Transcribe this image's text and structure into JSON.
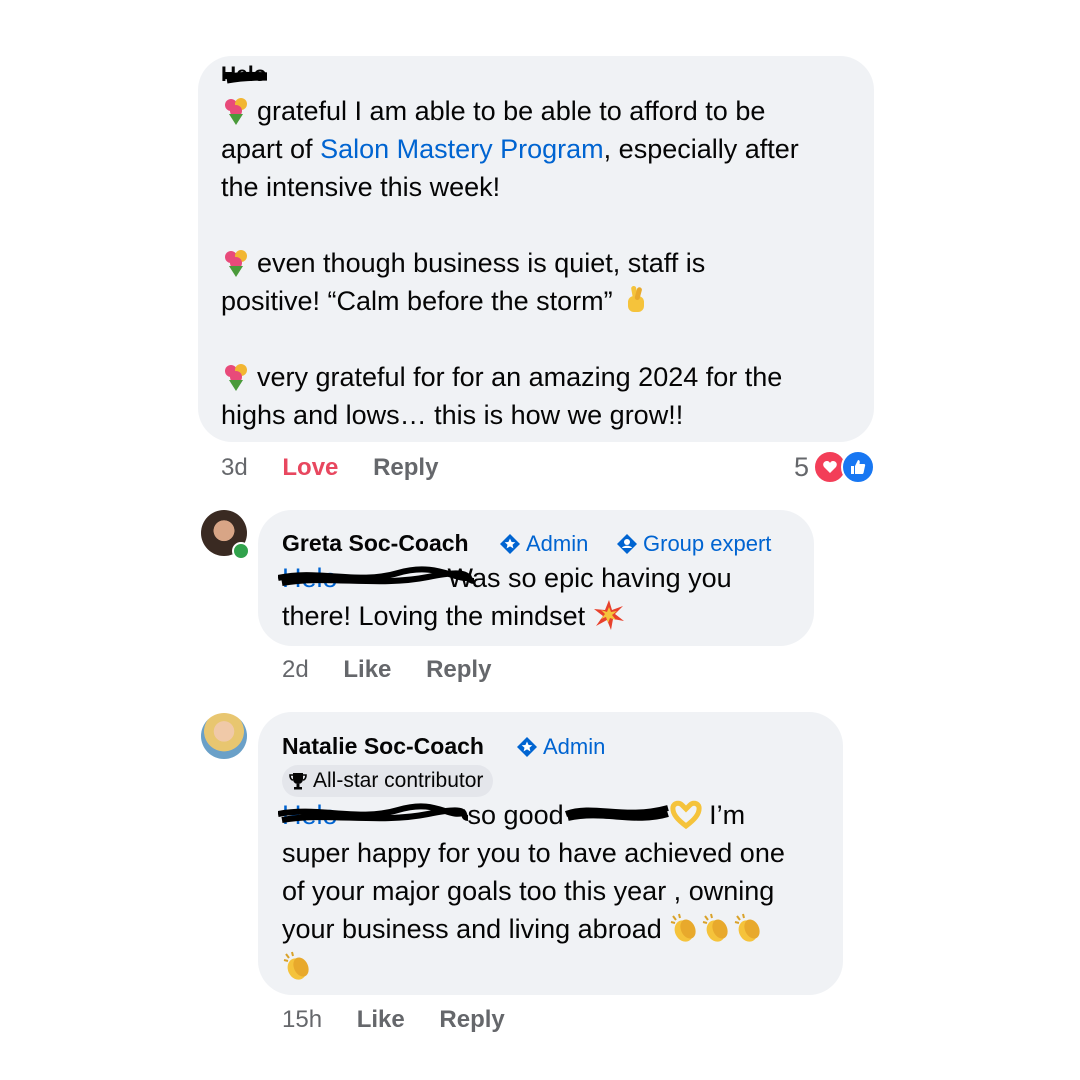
{
  "post": {
    "author": "Helo",
    "lines": [
      {
        "pre": "grateful I am able to be able to afford to be",
        "link": "",
        "post": ""
      },
      {
        "pre": "apart of ",
        "link": "Salon Mastery Program",
        "post": ", especially after"
      },
      {
        "pre": "the intensive this week!",
        "link": "",
        "post": ""
      },
      {
        "pre": "even though business is quiet, staff is",
        "link": "",
        "post": ""
      },
      {
        "pre": "positive! “Calm before the storm”",
        "link": "",
        "post": ""
      },
      {
        "pre": "very grateful for for an amazing 2024 for the",
        "link": "",
        "post": ""
      },
      {
        "pre": "highs and lows… this is how we grow!!",
        "link": "",
        "post": ""
      }
    ],
    "time": "3d",
    "love_label": "Love",
    "reply_label": "Reply",
    "reaction_count": "5"
  },
  "greta": {
    "name": "Greta Soc-Coach",
    "badge_admin": "Admin",
    "badge_expert": "Group expert",
    "mention": "Helo",
    "line1": "Was so epic having you",
    "line2": "there! Loving the mindset",
    "time": "2d",
    "like_label": "Like",
    "reply_label": "Reply"
  },
  "natalie": {
    "name": "Natalie Soc-Coach",
    "badge_admin": "Admin",
    "badge_allstar": "All-star contributor",
    "mention": "Helo",
    "line1_a": "so good",
    "line1_b": "I’m",
    "line2": "super happy for you to have achieved one",
    "line3": "of your major goals too this year , owning",
    "line4": "your business and living abroad",
    "time": "15h",
    "like_label": "Like",
    "reply_label": "Reply"
  },
  "colors": {
    "link": "#0064d1",
    "love": "#e8475f",
    "bubble": "#f0f2f5",
    "meta": "#65676b"
  },
  "icons": [
    "flower-bouquet-emoji",
    "crossed-fingers-emoji",
    "collision-emoji",
    "heart-hands-emoji",
    "clapping-hands-emoji",
    "heart-reaction-icon",
    "like-reaction-icon",
    "admin-shield-icon",
    "group-expert-icon",
    "trophy-icon"
  ]
}
